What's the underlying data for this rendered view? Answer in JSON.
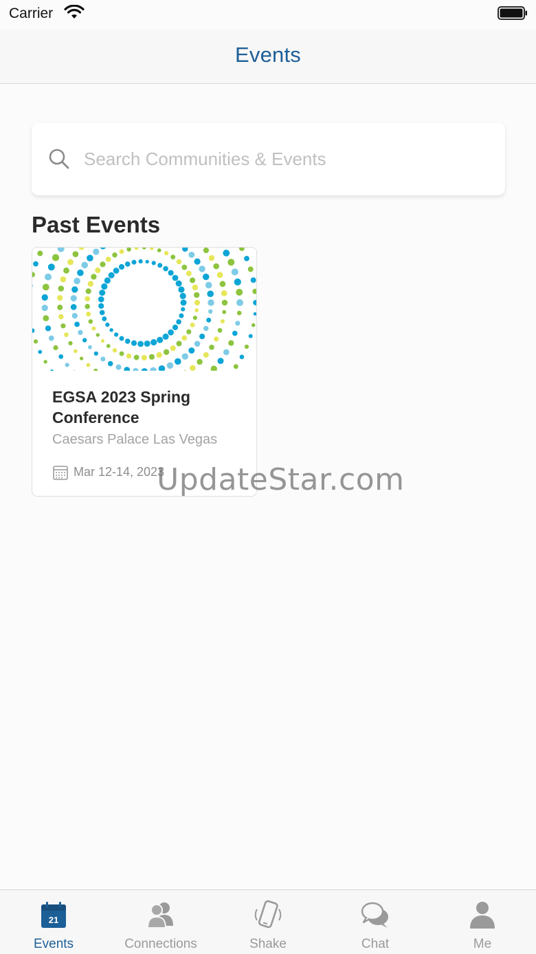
{
  "status_bar": {
    "carrier": "Carrier"
  },
  "nav": {
    "title": "Events"
  },
  "search": {
    "placeholder": "Search Communities & Events"
  },
  "section": {
    "title": "Past Events"
  },
  "events": [
    {
      "title": "EGSA 2023 Spring Conference",
      "venue": "Caesars Palace Las Vegas",
      "date": "Mar 12-14, 2023"
    }
  ],
  "watermark": "UpdateStar.com",
  "tabs": [
    {
      "label": "Events",
      "icon": "calendar-icon",
      "calendar_day": "21",
      "active": true
    },
    {
      "label": "Connections",
      "icon": "people-icon",
      "active": false
    },
    {
      "label": "Shake",
      "icon": "phone-shake-icon",
      "active": false
    },
    {
      "label": "Chat",
      "icon": "chat-bubbles-icon",
      "active": false
    },
    {
      "label": "Me",
      "icon": "person-icon",
      "active": false
    }
  ],
  "colors": {
    "accent": "#1d5f97",
    "tab_inactive": "#9a9a9a",
    "dot_blue": "#0da5d6",
    "dot_light_blue": "#7ecbe6",
    "dot_green": "#8cc43f",
    "dot_yellow": "#e6e65a"
  }
}
